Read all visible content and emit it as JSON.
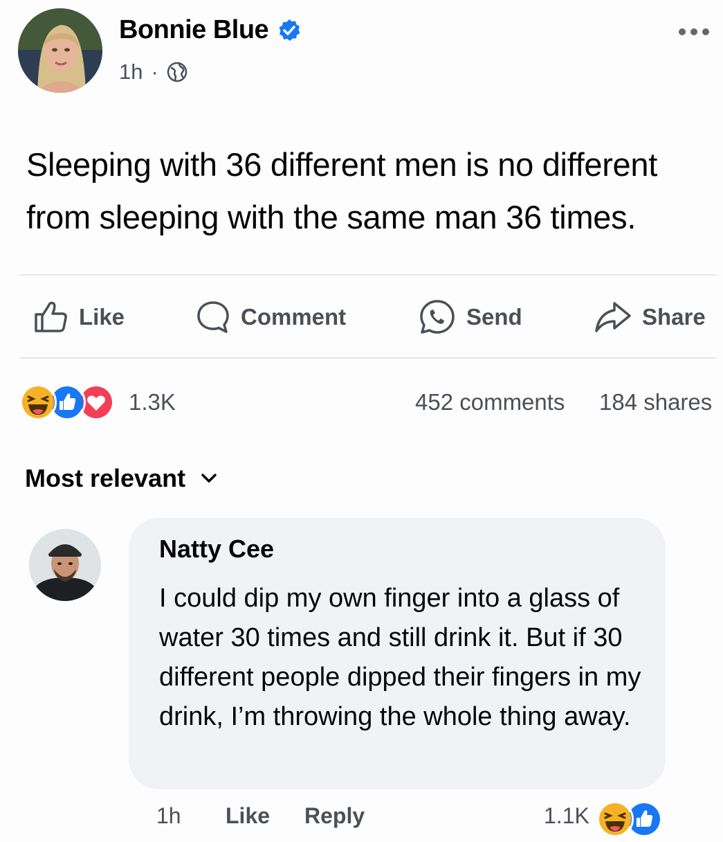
{
  "post": {
    "author": "Bonnie Blue",
    "time": "1h",
    "separator": "·",
    "text": "Sleeping with 36 different men is no different from sleeping with the same man 36 times."
  },
  "actions": {
    "like": "Like",
    "comment": "Comment",
    "send": "Send",
    "share": "Share"
  },
  "stats": {
    "reactions_count": "1.3K",
    "comments": "452 comments",
    "shares": "184 shares"
  },
  "sort": {
    "label": "Most relevant"
  },
  "comment": {
    "author": "Natty Cee",
    "text": "I could dip my own finger into a glass of water 30 times and still drink it. But if 30 different people dipped their fingers in my drink, I’m throwing the whole thing away.",
    "time": "1h",
    "like_label": "Like",
    "reply_label": "Reply",
    "reactions_count": "1.1K"
  },
  "colors": {
    "brand_blue": "#1877f2",
    "love_red": "#f33e58",
    "haha_yellow": "#f7b125",
    "text_secondary": "#4b4f56"
  }
}
